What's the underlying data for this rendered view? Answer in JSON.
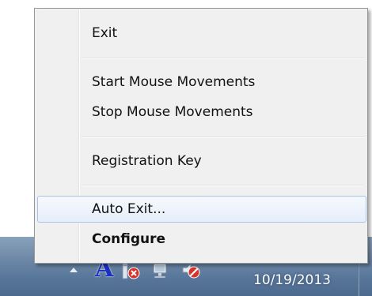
{
  "menu": {
    "items": {
      "exit": "Exit",
      "start_mouse": "Start Mouse Movements",
      "stop_mouse": "Stop Mouse Movements",
      "registration": "Registration Key",
      "auto_exit": "Auto Exit...",
      "configure": "Configure"
    },
    "hovered_item": "Auto Exit...",
    "default_item": "Configure"
  },
  "tray": {
    "show_hidden_icon": "chevron-up-icon",
    "icons": [
      "font-a-icon",
      "network-error-icon",
      "network-icon",
      "volume-muted-icon"
    ],
    "clock_date": "10/19/2013"
  },
  "colors": {
    "menu_bg": "#f0f0f0",
    "hover_bg": "#e6eef9",
    "hover_border": "#a8c3e6",
    "taskbar": "#58769a",
    "error_red": "#d9342b"
  }
}
